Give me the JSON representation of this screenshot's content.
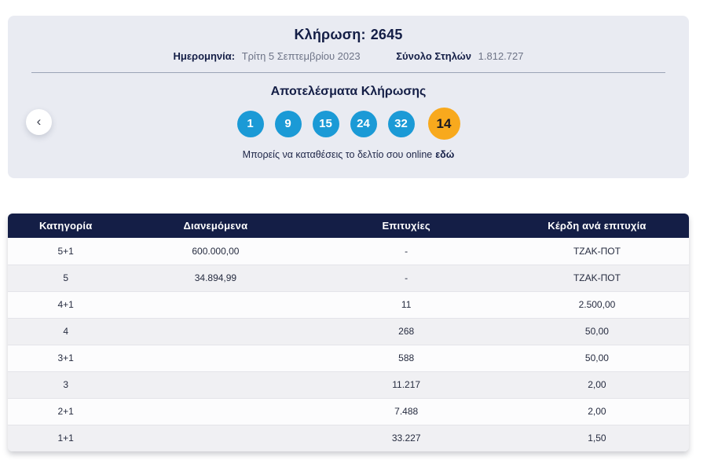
{
  "draw": {
    "title_label": "Κλήρωση:",
    "title_number": "2645",
    "date_label": "Ημερομηνία:",
    "date_value": "Τρίτη 5 Σεπτεμβρίου 2023",
    "columns_label": "Σύνολο Στηλών",
    "columns_value": "1.812.727",
    "results_title": "Αποτελέσματα Κλήρωσης",
    "numbers": [
      "1",
      "9",
      "15",
      "24",
      "32"
    ],
    "bonus_number": "14",
    "deposit_text": "Μπορείς να καταθέσεις το δελτίο σου online",
    "deposit_link_label": "εδώ"
  },
  "nav": {
    "prev_icon": "‹"
  },
  "table": {
    "headers": [
      "Κατηγορία",
      "Διανεμόμενα",
      "Επιτυχίες",
      "Κέρδη ανά επιτυχία"
    ],
    "rows": [
      [
        "5+1",
        "600.000,00",
        "-",
        "ΤΖΑΚ-ΠΟΤ"
      ],
      [
        "5",
        "34.894,99",
        "-",
        "ΤΖΑΚ-ΠΟΤ"
      ],
      [
        "4+1",
        "",
        "11",
        "2.500,00"
      ],
      [
        "4",
        "",
        "268",
        "50,00"
      ],
      [
        "3+1",
        "",
        "588",
        "50,00"
      ],
      [
        "3",
        "",
        "11.217",
        "2,00"
      ],
      [
        "2+1",
        "",
        "7.488",
        "2,00"
      ],
      [
        "1+1",
        "",
        "33.227",
        "1,50"
      ]
    ]
  },
  "colors": {
    "navy": "#141e46",
    "card_bg": "#e9ebf2",
    "ball_blue": "#1b9ad6",
    "ball_bonus_orange": "#f8a91d",
    "row_alt_bg": "#f0f0f3",
    "muted_text": "#6e7487"
  }
}
